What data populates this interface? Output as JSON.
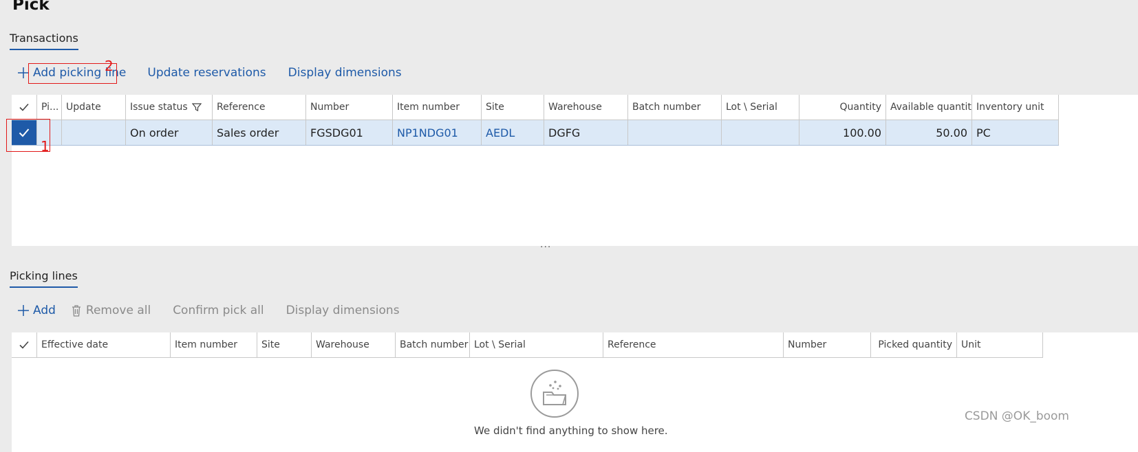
{
  "page": {
    "title": "Pick"
  },
  "transactions": {
    "tab_label": "Transactions",
    "toolbar": {
      "add_picking_line": "Add picking line",
      "update_reservations": "Update reservations",
      "display_dimensions": "Display dimensions"
    },
    "columns": {
      "pick": "Pi...",
      "update": "Update",
      "issue_status": "Issue status",
      "reference": "Reference",
      "number": "Number",
      "item_number": "Item number",
      "site": "Site",
      "warehouse": "Warehouse",
      "batch_number": "Batch number",
      "lot_serial": "Lot \\ Serial",
      "quantity": "Quantity",
      "available_quantity": "Available quantity",
      "inventory_unit": "Inventory unit"
    },
    "rows": [
      {
        "selected": true,
        "pick": "",
        "update": "",
        "issue_status": "On order",
        "reference": "Sales order",
        "number": "FGSDG01",
        "item_number": "NP1NDG01",
        "site": "AEDL",
        "warehouse": "DGFG",
        "batch_number": "",
        "lot_serial": "",
        "quantity": "100.00",
        "available_quantity": "50.00",
        "inventory_unit": "PC"
      }
    ]
  },
  "picking_lines": {
    "tab_label": "Picking lines",
    "toolbar": {
      "add": "Add",
      "remove_all": "Remove all",
      "confirm_pick_all": "Confirm pick all",
      "display_dimensions": "Display dimensions"
    },
    "columns": {
      "effective_date": "Effective date",
      "item_number": "Item number",
      "site": "Site",
      "warehouse": "Warehouse",
      "batch_number": "Batch number",
      "lot_serial": "Lot \\ Serial",
      "reference": "Reference",
      "number": "Number",
      "picked_quantity": "Picked quantity",
      "unit": "Unit"
    },
    "empty_message": "We didn't find anything to show here."
  },
  "annotations": {
    "one": "1",
    "two": "2"
  },
  "resize_handle": "...",
  "watermark": "CSDN @OK_boom",
  "colors": {
    "accent": "#1e5aa8",
    "annotation": "#e21818",
    "selected_row": "#dce9f7"
  }
}
